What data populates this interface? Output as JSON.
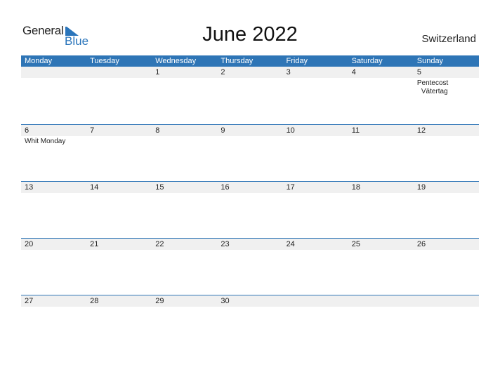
{
  "logo": {
    "word1": "General",
    "word2": "Blue"
  },
  "title": "June 2022",
  "country": "Switzerland",
  "colors": {
    "accent": "#2e75b6",
    "date_strip": "#f0f0f0"
  },
  "weekdays": [
    "Monday",
    "Tuesday",
    "Wednesday",
    "Thursday",
    "Friday",
    "Saturday",
    "Sunday"
  ],
  "weeks": [
    {
      "days": [
        {
          "num": "",
          "events": []
        },
        {
          "num": "",
          "events": []
        },
        {
          "num": "1",
          "events": []
        },
        {
          "num": "2",
          "events": []
        },
        {
          "num": "3",
          "events": []
        },
        {
          "num": "4",
          "events": []
        },
        {
          "num": "5",
          "events": [
            "Pentecost",
            "Vätertag"
          ]
        }
      ]
    },
    {
      "days": [
        {
          "num": "6",
          "events": [
            "Whit Monday"
          ]
        },
        {
          "num": "7",
          "events": []
        },
        {
          "num": "8",
          "events": []
        },
        {
          "num": "9",
          "events": []
        },
        {
          "num": "10",
          "events": []
        },
        {
          "num": "11",
          "events": []
        },
        {
          "num": "12",
          "events": []
        }
      ]
    },
    {
      "days": [
        {
          "num": "13",
          "events": []
        },
        {
          "num": "14",
          "events": []
        },
        {
          "num": "15",
          "events": []
        },
        {
          "num": "16",
          "events": []
        },
        {
          "num": "17",
          "events": []
        },
        {
          "num": "18",
          "events": []
        },
        {
          "num": "19",
          "events": []
        }
      ]
    },
    {
      "days": [
        {
          "num": "20",
          "events": []
        },
        {
          "num": "21",
          "events": []
        },
        {
          "num": "22",
          "events": []
        },
        {
          "num": "23",
          "events": []
        },
        {
          "num": "24",
          "events": []
        },
        {
          "num": "25",
          "events": []
        },
        {
          "num": "26",
          "events": []
        }
      ]
    },
    {
      "days": [
        {
          "num": "27",
          "events": []
        },
        {
          "num": "28",
          "events": []
        },
        {
          "num": "29",
          "events": []
        },
        {
          "num": "30",
          "events": []
        },
        {
          "num": "",
          "events": []
        },
        {
          "num": "",
          "events": []
        },
        {
          "num": "",
          "events": []
        }
      ]
    }
  ]
}
